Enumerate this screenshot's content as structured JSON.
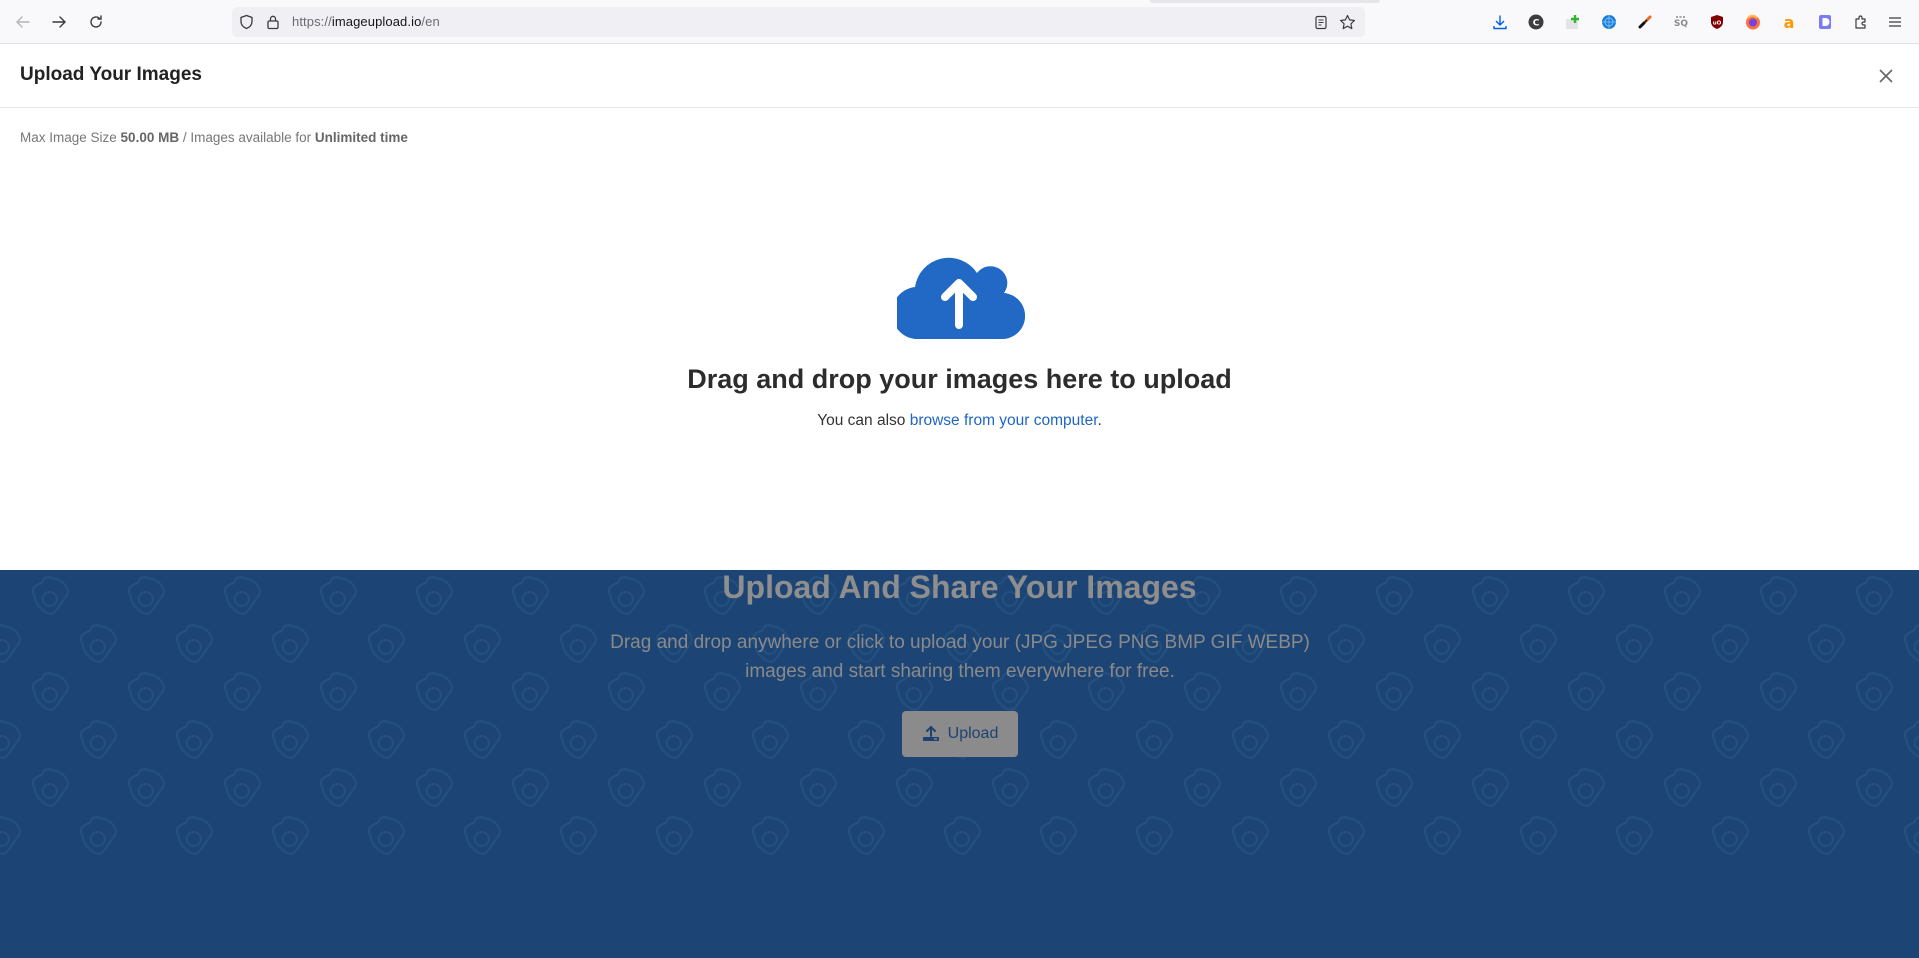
{
  "browser": {
    "url_prefix": "https://",
    "url_host": "imageupload.io",
    "url_path": "/en",
    "nav": [
      "back-icon",
      "forward-icon",
      "reload-icon"
    ],
    "urlbar_icons": [
      "shield-icon",
      "lock-icon",
      "reader-view-icon",
      "bookmark-star-icon"
    ],
    "extensions": [
      {
        "name": "downloads-icon",
        "color": "#0061e0"
      },
      {
        "name": "c-extension-icon",
        "color": "#3d3d3d"
      },
      {
        "name": "add-extension-icon",
        "color": "#2fb52f"
      },
      {
        "name": "globe-extension-icon",
        "color": "#1b7fd6"
      },
      {
        "name": "link-extension-icon",
        "color": "#f26a1b"
      },
      {
        "name": "sq-extension-icon",
        "color": "#8a8a8a"
      },
      {
        "name": "ublock-icon",
        "color": "#800000"
      },
      {
        "name": "firefox-icon",
        "color": "#ff7139"
      },
      {
        "name": "amazon-a-icon",
        "color": "#ff9900"
      },
      {
        "name": "d-extension-icon",
        "color": "#7b7bf7"
      },
      {
        "name": "extensions-puzzle-icon",
        "color": "#444"
      },
      {
        "name": "menu-icon",
        "color": "#444"
      }
    ]
  },
  "modal": {
    "title": "Upload Your Images",
    "limits": {
      "size_label": "Max Image Size ",
      "size_value": "50.00 MB",
      "sep": " / Images available for ",
      "time_value": "Unlimited time"
    },
    "drop_title": "Drag and drop your images here to upload",
    "drop_sub_prefix": "You can also ",
    "browse_link": "browse from your computer",
    "drop_sub_suffix": ".",
    "accent": "#2169c4"
  },
  "hero": {
    "title": "Upload And Share Your Images",
    "description": "Drag and drop anywhere or click to upload your (JPG JPEG PNG BMP GIF WEBP) images and start sharing them everywhere for free.",
    "upload_label": "Upload",
    "background": "#1c4474"
  }
}
